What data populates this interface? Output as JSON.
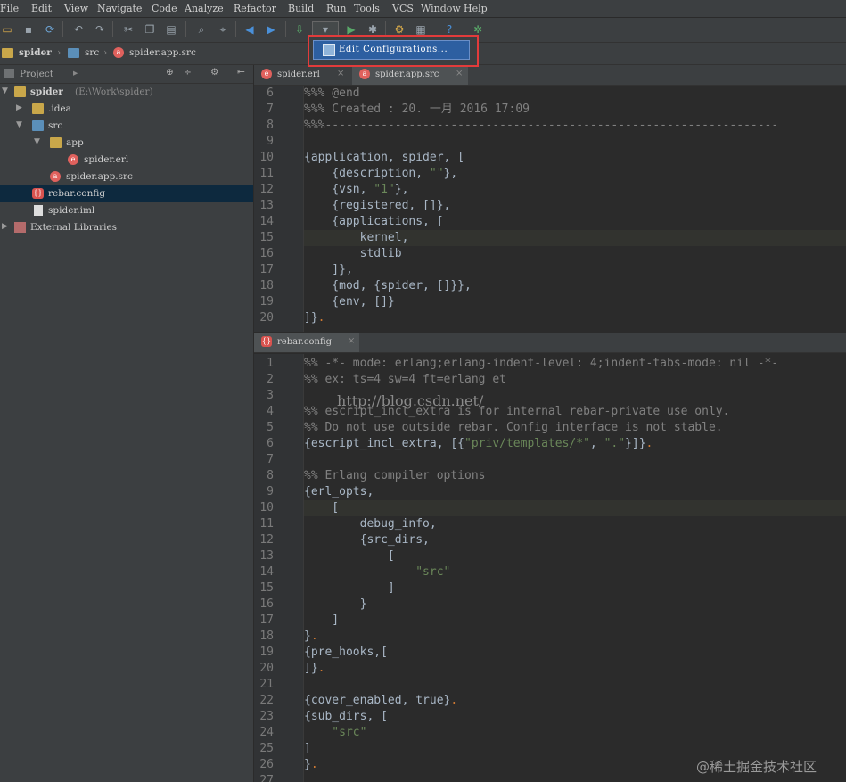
{
  "menu": [
    "File",
    "Edit",
    "View",
    "Navigate",
    "Code",
    "Analyze",
    "Refactor",
    "Build",
    "Run",
    "Tools",
    "VCS",
    "Window",
    "Help"
  ],
  "toolbar_icons": [
    "open-folder-icon",
    "save-icon",
    "sync-icon",
    "undo-icon",
    "redo-icon",
    "cut-icon",
    "copy-icon",
    "paste-icon",
    "find-icon",
    "replace-icon",
    "back-icon",
    "forward-icon",
    "build-icon",
    "run-config-dropdown-icon",
    "run-icon",
    "debug-icon",
    "settings-icon",
    "project-structure-icon",
    "help-icon",
    "plugin-icon"
  ],
  "breadcrumb": [
    "spider",
    "src",
    "spider.app.src"
  ],
  "popup": {
    "label": "Edit Configurations..."
  },
  "project_panel": {
    "title": "Project"
  },
  "tree": [
    {
      "label": "spider",
      "extra": "(E:\\Work\\spider)"
    },
    {
      "label": ".idea"
    },
    {
      "label": "src"
    },
    {
      "label": "app"
    },
    {
      "label": "spider.erl"
    },
    {
      "label": "spider.app.src"
    },
    {
      "label": "rebar.config"
    },
    {
      "label": "spider.iml"
    },
    {
      "label": "External Libraries"
    }
  ],
  "top_tabs": [
    {
      "label": "spider.erl",
      "icon": "e"
    },
    {
      "label": "spider.app.src",
      "icon": "a"
    }
  ],
  "top_lines": {
    "numbers": [
      "6",
      "7",
      "8",
      "9",
      "10",
      "11",
      "12",
      "13",
      "14",
      "15",
      "16",
      "17",
      "18",
      "19",
      "20"
    ],
    "l6": "%%% @end",
    "l7": "%%% Created : 20. 一月 2016 17:09",
    "l8": "%%%-----------------------------------------------------------------",
    "l9": "",
    "l10": "{application, spider, [",
    "l11a": "    {description, ",
    "l11s": "\"\"",
    "l11b": "},",
    "l12a": "    {vsn, ",
    "l12s": "\"1\"",
    "l12b": "},",
    "l13": "    {registered, []},",
    "l14": "    {applications, [",
    "l15": "        kernel,",
    "l16": "        stdlib",
    "l17": "    ]},",
    "l18": "    {mod, {spider, []}},",
    "l19": "    {env, []}",
    "l20a": "]}",
    "l20b": "."
  },
  "bottom_tab": {
    "label": "rebar.config"
  },
  "bottom_lines": {
    "numbers": [
      "1",
      "2",
      "3",
      "4",
      "5",
      "6",
      "7",
      "8",
      "9",
      "10",
      "11",
      "12",
      "13",
      "14",
      "15",
      "16",
      "17",
      "18",
      "19",
      "20",
      "21",
      "22",
      "23",
      "24",
      "25",
      "26",
      "27"
    ],
    "l1": "%% -*- mode: erlang;erlang-indent-level: 4;indent-tabs-mode: nil -*-",
    "l2": "%% ex: ts=4 sw=4 ft=erlang et",
    "l3": "",
    "l4": "%% escript_incl_extra is for internal rebar-private use only.",
    "l5": "%% Do not use outside rebar. Config interface is not stable.",
    "l6a": "{escript_incl_extra, [{",
    "l6s1": "\"priv/templates/*\"",
    "l6m": ", ",
    "l6s2": "\".\"",
    "l6b": "}]}",
    "l6d": ".",
    "l7": "",
    "l8": "%% Erlang compiler options",
    "l9": "{erl_opts,",
    "l10": "    [",
    "l11": "        debug_info,",
    "l12": "        {src_dirs,",
    "l13": "            [",
    "l14": "                \"src\"",
    "l15": "            ]",
    "l16": "        }",
    "l17": "    ]",
    "l18a": "}",
    "l18b": ".",
    "l19": "{pre_hooks,[",
    "l20a": "]}",
    "l20b": ".",
    "l21": "",
    "l22a": "{cover_enabled, true}",
    "l22b": ".",
    "l23": "{sub_dirs, [",
    "l24": "    \"src\"",
    "l25": "]",
    "l26a": "}",
    "l26b": ".",
    "l27": ""
  },
  "watermark_url": "http://blog.csdn.net/",
  "watermark_site": "@稀土掘金技术社区"
}
